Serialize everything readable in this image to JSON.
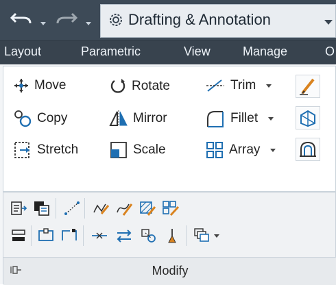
{
  "quick_access": {
    "undo_icon": "undo-arrow-icon",
    "redo_icon": "redo-arrow-icon",
    "workspace_label": "Drafting & Annotation"
  },
  "ribbon_tabs": [
    "Layout",
    "Parametric",
    "View",
    "Manage",
    "O"
  ],
  "modify_panel": {
    "title": "Modify",
    "tools": {
      "move": "Move",
      "rotate": "Rotate",
      "trim": "Trim",
      "copy": "Copy",
      "mirror": "Mirror",
      "fillet": "Fillet",
      "stretch": "Stretch",
      "scale": "Scale",
      "array": "Array"
    }
  },
  "colors": {
    "qat_bg": "#3d4a57",
    "tabs_bg": "#38434e",
    "panel_bg": "#f3f5f7",
    "icon_blue": "#1f6fb2",
    "icon_orange": "#d9831f"
  }
}
